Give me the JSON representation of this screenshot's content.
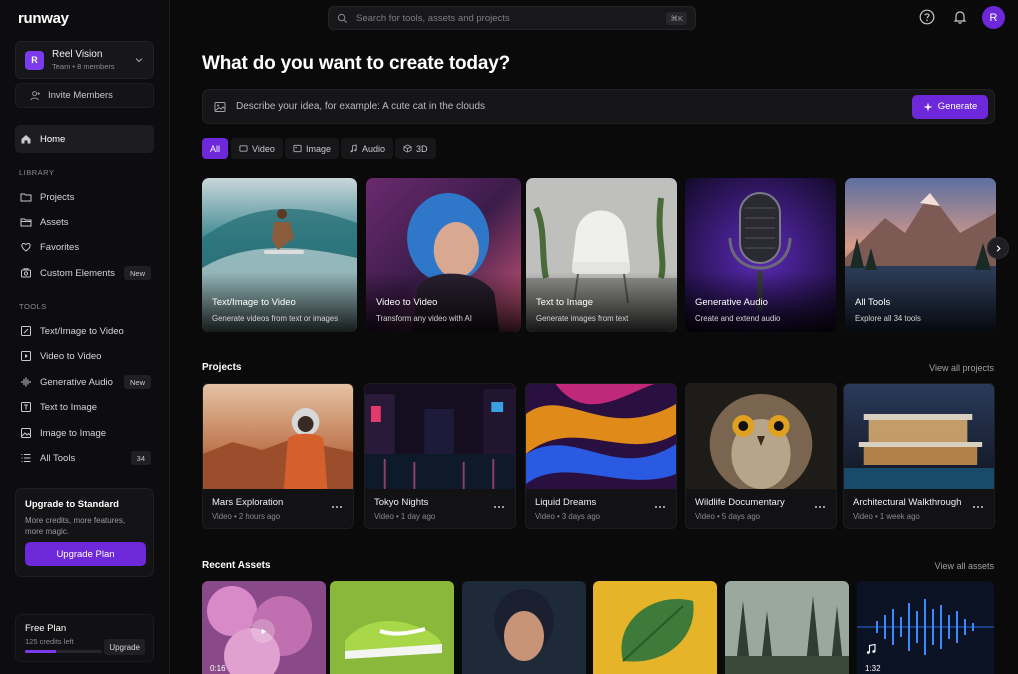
{
  "brand": {
    "logo": "runway"
  },
  "team": {
    "avatar": "R",
    "name": "Reel Vision",
    "sub": "Team • 8 members"
  },
  "invite_label": "Invite Members",
  "nav": {
    "home": "Home",
    "library_label": "LIBRARY",
    "library": [
      {
        "label": "Projects",
        "icon": "folder-icon"
      },
      {
        "label": "Assets",
        "icon": "assets-folder-icon"
      },
      {
        "label": "Favorites",
        "icon": "heart-icon"
      },
      {
        "label": "Custom Elements",
        "icon": "elements-icon",
        "badge": "New"
      }
    ],
    "tools_label": "TOOLS",
    "tools": [
      {
        "label": "Text/Image to Video",
        "icon": "video-edit-icon"
      },
      {
        "label": "Video to Video",
        "icon": "video-icon"
      },
      {
        "label": "Generative Audio",
        "icon": "audio-wave-icon",
        "badge": "New"
      },
      {
        "label": "Text to Image",
        "icon": "text-image-icon"
      },
      {
        "label": "Image to Image",
        "icon": "image-icon"
      },
      {
        "label": "All Tools",
        "icon": "list-icon",
        "badge": "34"
      }
    ]
  },
  "upgrade": {
    "title": "Upgrade to Standard",
    "desc": "More credits, more features, more magic.",
    "button": "Upgrade Plan"
  },
  "plan": {
    "name": "Free Plan",
    "credits": "125 credits left",
    "button": "Upgrade",
    "progress": 0.4
  },
  "search": {
    "placeholder": "Search for tools, assets and projects",
    "shortcut": "⌘K"
  },
  "header": {
    "avatar": "R"
  },
  "hero": {
    "headline": "What do you want to create today?",
    "prompt_placeholder": "Describe your idea, for example: A cute cat in the clouds",
    "generate": "Generate"
  },
  "filters": [
    "All",
    "Video",
    "Image",
    "Audio",
    "3D"
  ],
  "tools_cards": [
    {
      "title": "Text/Image to Video",
      "sub": "Generate videos from text or images"
    },
    {
      "title": "Video to Video",
      "sub": "Transform any video with AI"
    },
    {
      "title": "Text to Image",
      "sub": "Generate images from text"
    },
    {
      "title": "Generative Audio",
      "sub": "Create and extend audio"
    },
    {
      "title": "All Tools",
      "sub": "Explore all 34 tools"
    }
  ],
  "projects": {
    "title": "Projects",
    "link": "View all projects",
    "items": [
      {
        "title": "Mars Exploration",
        "meta": "Video  •  2 hours ago"
      },
      {
        "title": "Tokyo Nights",
        "meta": "Video  •  1 day ago"
      },
      {
        "title": "Liquid Dreams",
        "meta": "Video  •  3 days ago"
      },
      {
        "title": "Wildlife Documentary",
        "meta": "Video  •  5 days ago"
      },
      {
        "title": "Architectural Walkthrough",
        "meta": "Video  •  1 week ago"
      }
    ]
  },
  "assets": {
    "title": "Recent Assets",
    "link": "View all assets",
    "items": [
      {
        "duration": "0:16"
      },
      {
        "duration": ""
      },
      {
        "duration": ""
      },
      {
        "duration": ""
      },
      {
        "duration": ""
      },
      {
        "duration": "1:32"
      }
    ]
  }
}
